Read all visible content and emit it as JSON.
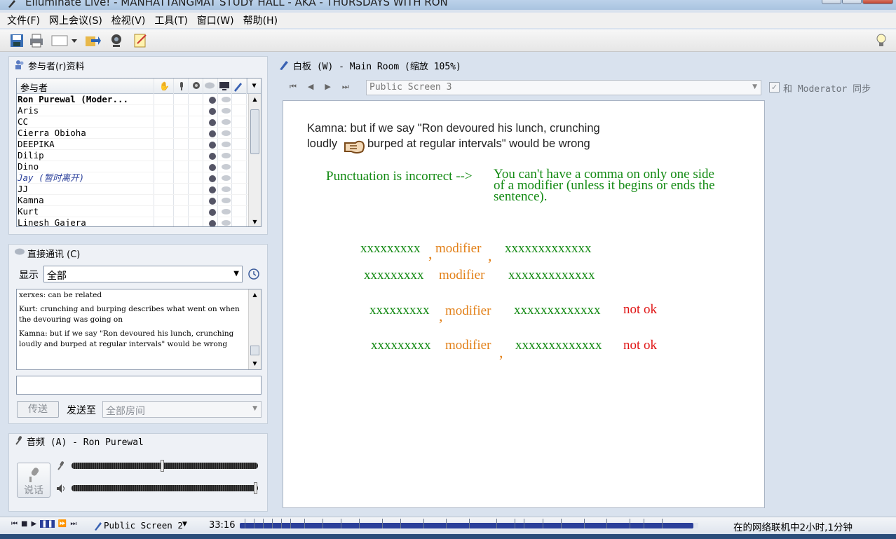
{
  "window": {
    "title": "Elluminate Live! - MANHATTANGMAT STUDY HALL - AKA - THURSDAYS WITH RON"
  },
  "menu": [
    "文件(F)",
    "网上会议(S)",
    "检视(V)",
    "工具(T)",
    "窗口(W)",
    "帮助(H)"
  ],
  "participants": {
    "title": "参与者(r)资料",
    "header": "参与者",
    "rows": [
      {
        "name": "Ron Purewal (Moder...",
        "bold": true
      },
      {
        "name": "Aris"
      },
      {
        "name": "CC"
      },
      {
        "name": "Cierra Obioha"
      },
      {
        "name": "DEEPIKA"
      },
      {
        "name": "Dilip"
      },
      {
        "name": "Dino"
      },
      {
        "name": "Jay (暂时离开)",
        "away": true
      },
      {
        "name": "JJ"
      },
      {
        "name": "Kamna"
      },
      {
        "name": "Kurt"
      },
      {
        "name": "Linesh Gajera"
      }
    ]
  },
  "chat": {
    "title": "直接通讯 (C)",
    "show_label": "显示",
    "filter_value": "全部",
    "messages": [
      "xerxes: can be related",
      "Kurt: crunching and burping describes what went on when the devouring was going on",
      "Kamna: but if we say \"Ron devoured his lunch, crunching loudly and burped at regular intervals\" would be wrong"
    ],
    "input_value": "",
    "send_label": "传送",
    "send_to_label": "发送至",
    "send_to_value": "全部房间"
  },
  "audio": {
    "title": "音频 (A) - Ron Purewal",
    "talk_label": "说话",
    "mic_level": 0.49,
    "speaker_level": 1.0
  },
  "whiteboard": {
    "title": "白板 (W) - Main Room (缩放 105%)",
    "screen_value": "Public Screen 3",
    "sync_label": "和 Moderator 同步",
    "sync_checked": true,
    "quote_line1": "Kamna: but if we say \"Ron devoured his lunch, crunching",
    "quote_line2_a": "loudly",
    "quote_line2_b": "burped at regular intervals\" would be wrong",
    "punct_label": "Punctuation is incorrect -->",
    "punct_text1": "You can't have a comma on only one side",
    "punct_text2": "of a modifier (unless it begins or ends the",
    "punct_text3": "sentence).",
    "x9": "xxxxxxxxx",
    "x13": "xxxxxxxxxxxxx",
    "modifier": "modifier",
    "comma": ",",
    "not_ok": "not ok"
  },
  "status": {
    "screen_label": "Public Screen 2",
    "time": "33:16",
    "progress": 0.99,
    "right_text": "在的网络联机中2小时,1分钟"
  },
  "colors": {
    "accent": "#2a3f9a",
    "green_text": "#138a13",
    "orange_text": "#e27f16",
    "red_text": "#e01515"
  }
}
